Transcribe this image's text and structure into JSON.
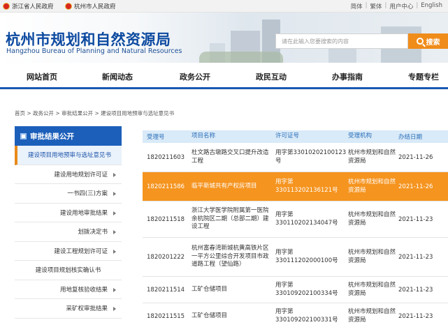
{
  "topbar": {
    "link1": "浙江省人民政府",
    "link2": "杭州市人民政府",
    "right_links": [
      "简体",
      "繁体",
      "用户中心",
      "English"
    ],
    "separator": "|"
  },
  "header": {
    "title": "杭州市规划和自然资源局",
    "subtitle": "Hangzhou Bureau of Planning and Natural Resources",
    "search_placeholder": "请在此输入您要搜索的内容",
    "search_button": "搜索"
  },
  "nav": {
    "items": [
      "网站首页",
      "新闻动态",
      "政务公开",
      "政民互动",
      "办事指南",
      "专题专栏"
    ]
  },
  "breadcrumb": "首页 > 政务公开 > 审批结果公开 > 建设项目用地预审与选址意见书",
  "sidebar": {
    "heading": "审批结果公开",
    "items": [
      "建设项目用地预审与选址意见书",
      "建设用地规划许可证",
      "一书四(三)方案",
      "建设用地审批结果",
      "划拨决定书",
      "建设工程规划许可证",
      "建设项目规划核实确认书",
      "用地复核验收结果",
      "采矿权审批结果"
    ]
  },
  "table": {
    "headers": [
      "受理号",
      "项目名称",
      "许可证号",
      "受理机构",
      "办结日期"
    ],
    "rows": [
      {
        "id": "1820211603",
        "name": "杜文路古墩路交叉口提升改造工程",
        "permit": "用字第330102021001​23号",
        "org": "杭州市规划和自然资源局",
        "date": "2021-11-26"
      },
      {
        "id": "1820211586",
        "name": "临平新城共有产权房项目",
        "permit": "用字第330113202136121号",
        "org": "杭州市规划和自然资源局",
        "date": "2021-11-26"
      },
      {
        "id": "1820211518",
        "name": "浙江大学医学院附属第一医院余杭院区二期（总部二期）建设工程",
        "permit": "用字第330110202134047号",
        "org": "杭州市规划和自然资源局",
        "date": "2021-11-23"
      },
      {
        "id": "1820201222",
        "name": "杭州富春湾新城杭黄高铁片区一平方公里综合开发项目市政道路工程（望仙路）",
        "permit": "用字第330111202000100号",
        "org": "杭州市规划和自然资源局",
        "date": "2021-11-23"
      },
      {
        "id": "1820211514",
        "name": "工矿仓储项目",
        "permit": "用字第330109202100334号",
        "org": "杭州市规划和自然资源局",
        "date": "2021-11-23"
      },
      {
        "id": "1820211515",
        "name": "工矿仓储项目",
        "permit": "用字第330109202100331号",
        "org": "杭州市规划和自然资源局",
        "date": "2021-11-23"
      }
    ]
  },
  "colors": {
    "brand_blue": "#1757b2",
    "highlight_orange": "#f5941f",
    "search_orange": "#f08c1a"
  }
}
